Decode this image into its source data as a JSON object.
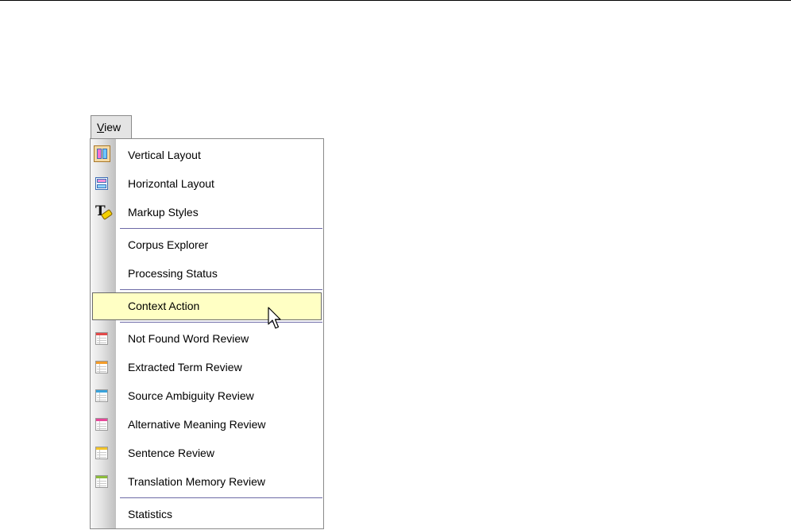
{
  "menu": {
    "title": "View",
    "title_mnemonic": "V",
    "title_rest": "iew",
    "items": [
      {
        "label": "Vertical Layout",
        "icon": "vertical-layout-icon"
      },
      {
        "label": "Horizontal Layout",
        "icon": "horizontal-layout-icon"
      },
      {
        "label": "Markup Styles",
        "icon": "markup-styles-icon"
      },
      {
        "label": "Corpus Explorer",
        "icon": ""
      },
      {
        "label": "Processing Status",
        "icon": ""
      },
      {
        "label": "Context Action",
        "icon": "",
        "highlighted": true
      },
      {
        "label": "Not Found Word Review",
        "icon": "review-grid-icon",
        "accent": "#e34a4a"
      },
      {
        "label": "Extracted Term Review",
        "icon": "review-grid-icon",
        "accent": "#f39c2b"
      },
      {
        "label": "Source Ambiguity Review",
        "icon": "review-grid-icon",
        "accent": "#3aa3dc"
      },
      {
        "label": "Alternative Meaning Review",
        "icon": "review-grid-icon",
        "accent": "#e8489a"
      },
      {
        "label": "Sentence Review",
        "icon": "review-grid-icon",
        "accent": "#f2c42a"
      },
      {
        "label": "Translation Memory Review",
        "icon": "review-grid-icon",
        "accent": "#8cbc3c"
      },
      {
        "label": "Statistics",
        "icon": ""
      }
    ]
  },
  "colors": {
    "highlight_bg": "#ffffc4",
    "separator": "#6d6aa6",
    "gutter": "#d4d4d4"
  }
}
